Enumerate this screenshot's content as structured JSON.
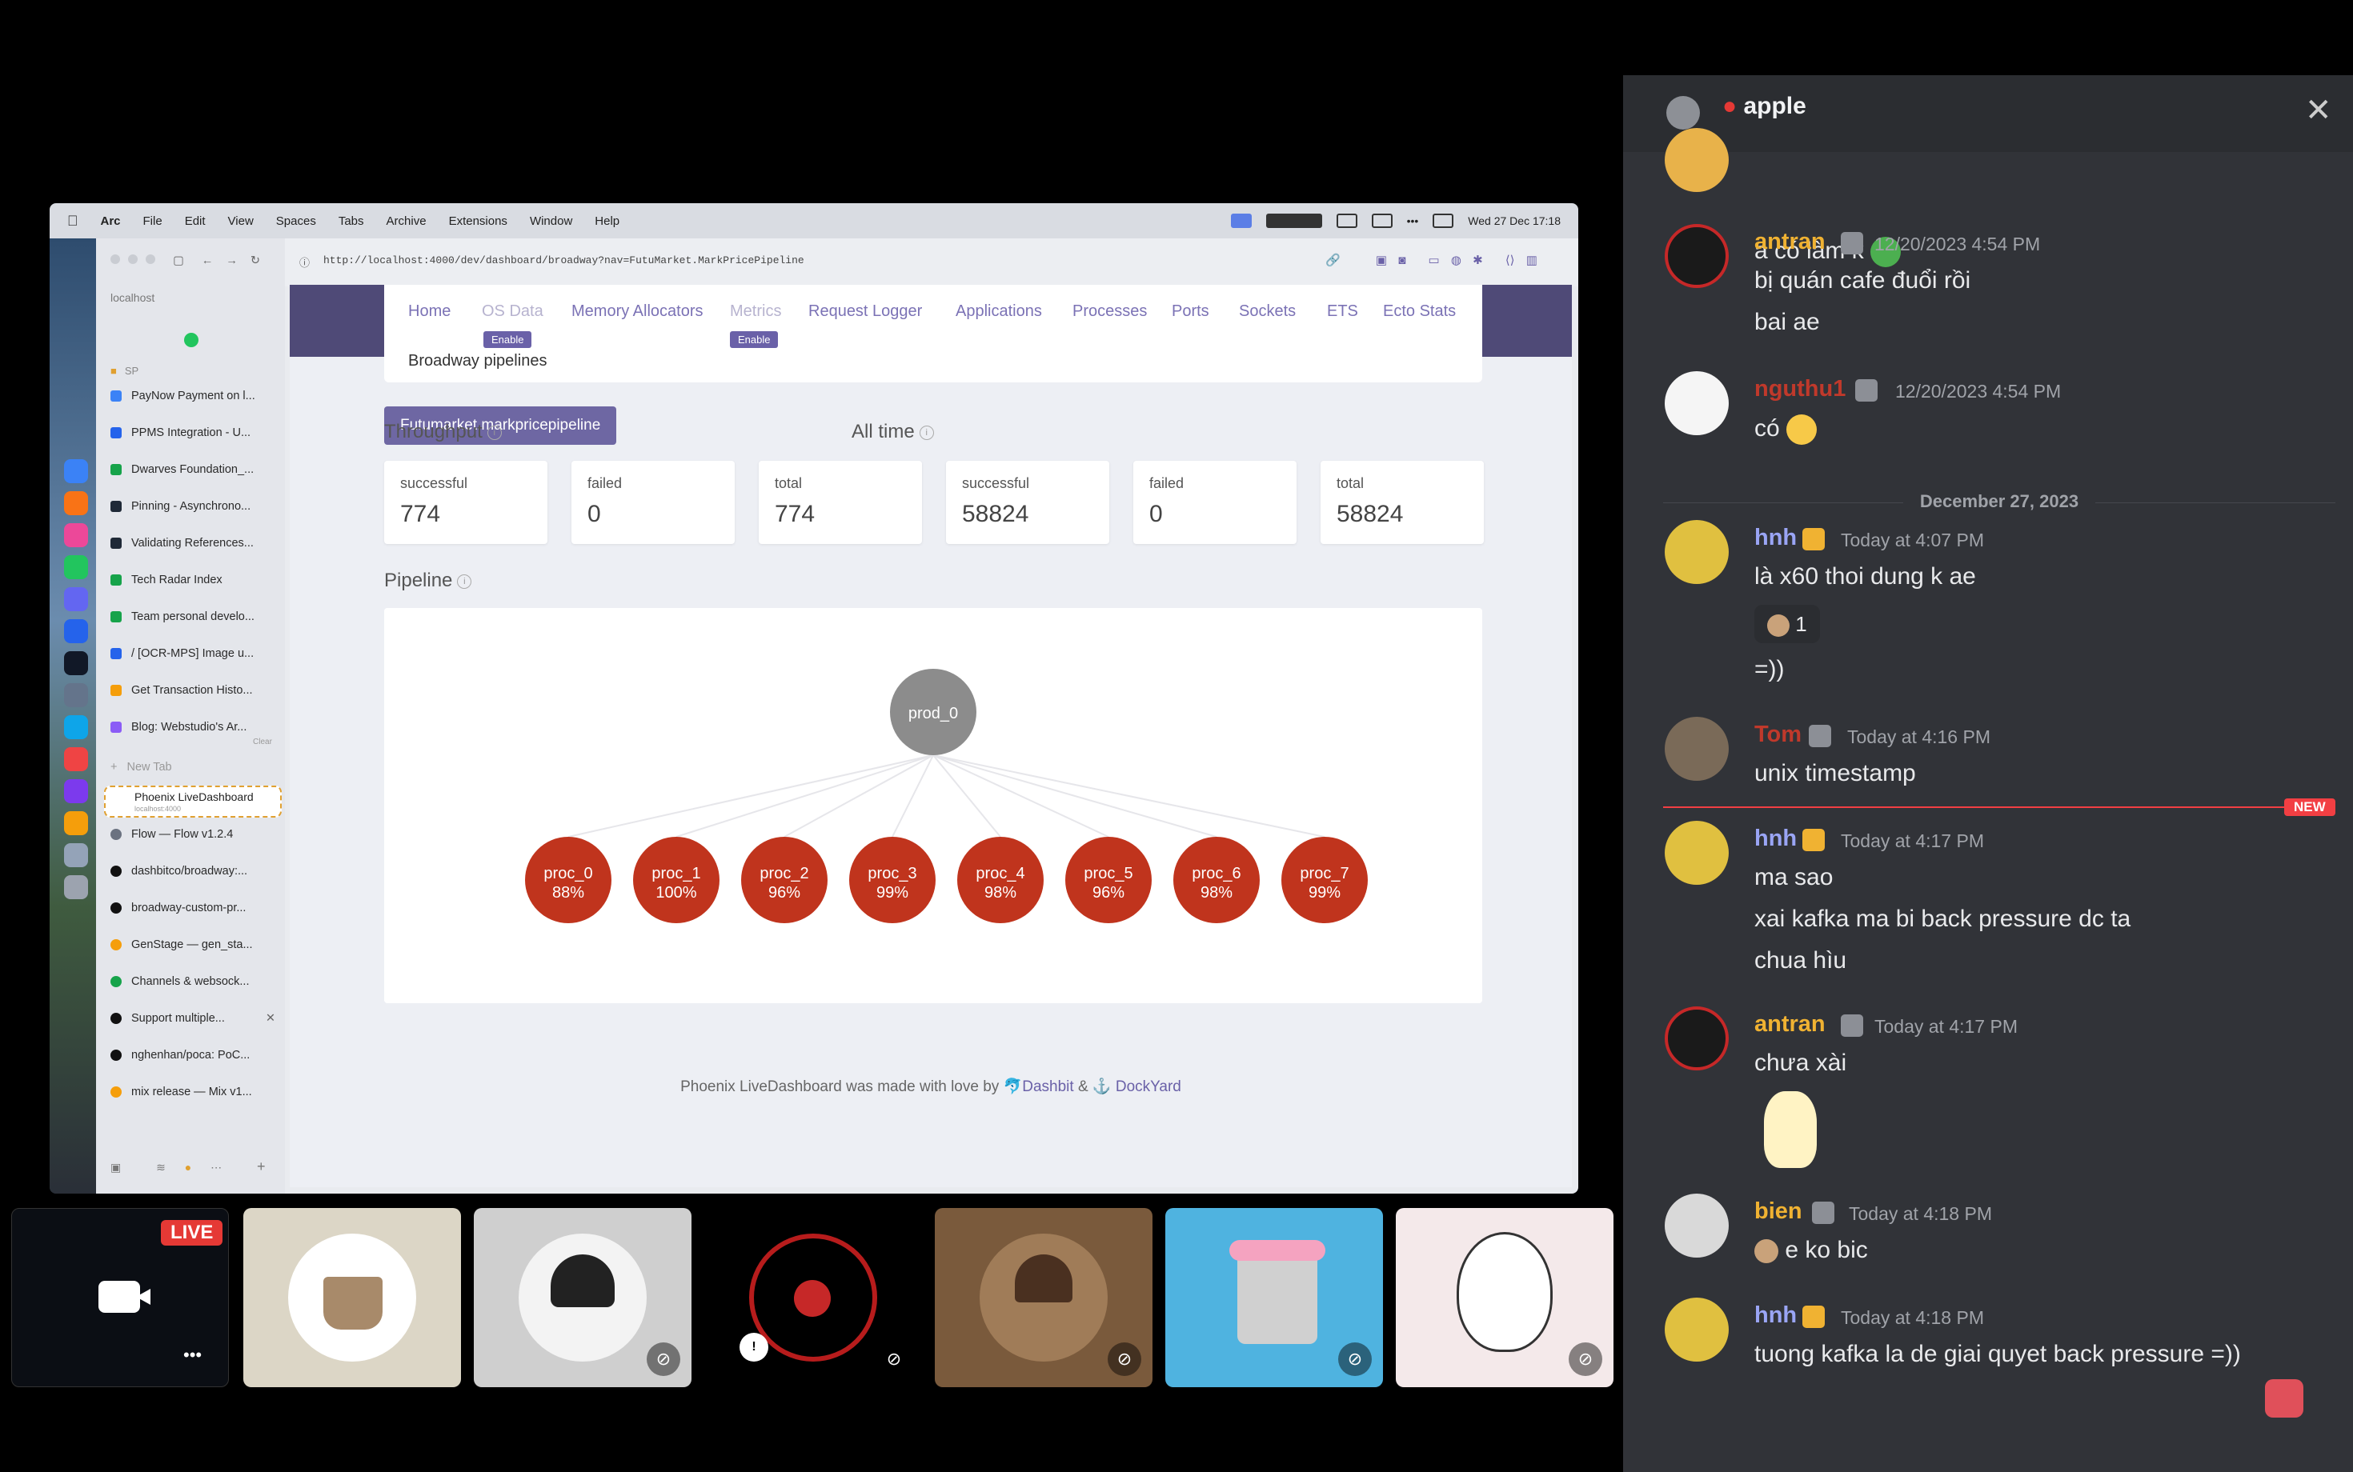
{
  "mac_menubar": {
    "items": [
      "Arc",
      "File",
      "Edit",
      "View",
      "Spaces",
      "Tabs",
      "Archive",
      "Extensions",
      "Window",
      "Help"
    ],
    "clock": "Wed 27 Dec  17:18"
  },
  "arc_sidebar": {
    "address": "localhost",
    "section_label": "SP",
    "pinned": [
      "PayNow Payment on l...",
      "PPMS Integration - U...",
      "Dwarves Foundation_...",
      "Pinning - Asynchrono...",
      "Validating References...",
      "Tech Radar Index",
      "Team personal develo...",
      "/ [OCR-MPS] Image u...",
      "Get Transaction Histo...",
      "Blog: Webstudio's Ar..."
    ],
    "clear_label": "Clear",
    "new_tab": "New Tab",
    "active_tab": "Phoenix LiveDashboard",
    "active_tab_sub": "localhost:4000",
    "tabs": [
      "Flow — Flow v1.2.4",
      "dashbitco/broadway:...",
      "broadway-custom-pr...",
      "GenStage — gen_sta...",
      "Channels & websock...",
      "Support multiple...",
      "nghenhan/pocа: PoC...",
      "mix release — Mix v1..."
    ]
  },
  "browser": {
    "url": "http://localhost:4000/dev/dashboard/broadway?nav=FutuMarket.MarkPricePipeline"
  },
  "dashboard": {
    "nav": [
      "Home",
      "OS Data",
      "Memory Allocators",
      "Metrics",
      "Request Logger",
      "Applications",
      "Processes",
      "Ports",
      "Sockets",
      "ETS",
      "Ecto Stats"
    ],
    "enable_label": "Enable",
    "subtitle": "Broadway pipelines",
    "pipeline_chip": "Futumarket.markpricepipeline",
    "throughput_title": "Throughput",
    "alltime_title": "All time",
    "throughput": [
      {
        "label": "successful",
        "value": "774"
      },
      {
        "label": "failed",
        "value": "0"
      },
      {
        "label": "total",
        "value": "774"
      }
    ],
    "alltime": [
      {
        "label": "successful",
        "value": "58824"
      },
      {
        "label": "failed",
        "value": "0"
      },
      {
        "label": "total",
        "value": "58824"
      }
    ],
    "pipeline_title": "Pipeline",
    "producer": "prod_0",
    "processors": [
      {
        "name": "proc_0",
        "pct": "88%"
      },
      {
        "name": "proc_1",
        "pct": "100%"
      },
      {
        "name": "proc_2",
        "pct": "96%"
      },
      {
        "name": "proc_3",
        "pct": "99%"
      },
      {
        "name": "proc_4",
        "pct": "98%"
      },
      {
        "name": "proc_5",
        "pct": "96%"
      },
      {
        "name": "proc_6",
        "pct": "98%"
      },
      {
        "name": "proc_7",
        "pct": "99%"
      }
    ],
    "footer_prefix": "Phoenix LiveDashboard was made with love by",
    "footer_dashbit": "Dashbit",
    "footer_amp": "&",
    "footer_dockyard": "DockYard"
  },
  "call": {
    "live_label": "LIVE",
    "more_label": "•••"
  },
  "chat": {
    "channel": "apple",
    "new_label": "NEW",
    "date_divider": "December 27, 2023",
    "messages": [
      {
        "user": "",
        "time": "",
        "lines": [
          "a có làm k"
        ]
      },
      {
        "user": "antran",
        "time": "12/20/2023 4:54 PM",
        "lines": [
          "bị quán cafe đuổi rồi",
          "bai ae"
        ]
      },
      {
        "user": "nguthu1",
        "time": "12/20/2023 4:54 PM",
        "lines": [
          "có"
        ]
      },
      {
        "user": "hnh",
        "time": "Today at 4:07 PM",
        "lines": [
          "là x60 thoi dung k ae",
          "1",
          "=))"
        ]
      },
      {
        "user": "Tom",
        "time": "Today at 4:16 PM",
        "lines": [
          "unix timestamp"
        ]
      },
      {
        "user": "hnh",
        "time": "Today at 4:17 PM",
        "lines": [
          "ma sao",
          "xai kafka ma bi back pressure dc ta",
          "chua hìu"
        ]
      },
      {
        "user": "antran",
        "time": "Today at 4:17 PM",
        "lines": [
          "chưa xài"
        ]
      },
      {
        "user": "bien",
        "time": "Today at 4:18 PM",
        "lines": [
          "e ko bic"
        ]
      },
      {
        "user": "hnh",
        "time": "Today at 4:18 PM",
        "lines": [
          "tuong kafka la de giai quyet back pressure =))"
        ]
      }
    ]
  },
  "colors": {
    "dashboard_accent": "#6e67a3",
    "processor_node": "#c0341d",
    "producer_node": "#8c8c8c",
    "chat_bg": "#313338",
    "new_divider": "#f23f43",
    "user_antran": "#f0b232",
    "user_hnh": "#9aa5f5",
    "user_bien": "#f0b232",
    "user_red": "#c0392b"
  }
}
